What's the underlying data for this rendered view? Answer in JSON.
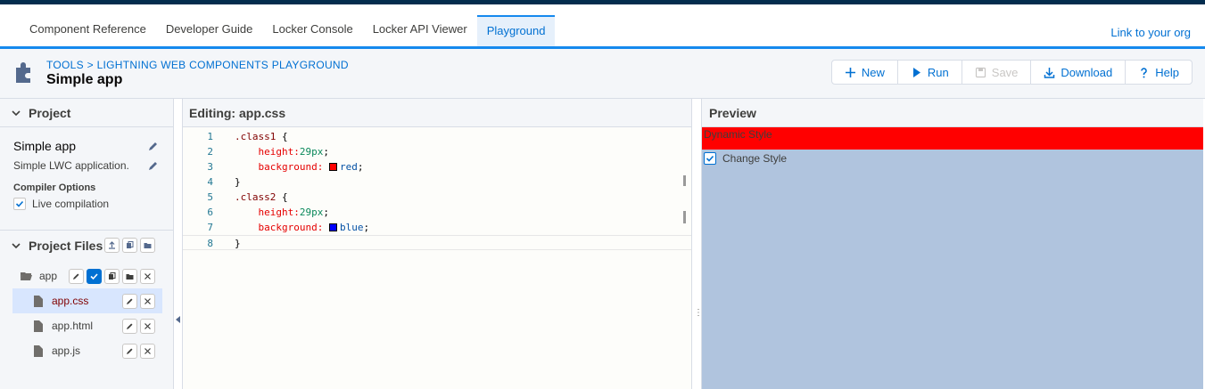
{
  "nav": {
    "tabs": [
      "Component Reference",
      "Developer Guide",
      "Locker Console",
      "Locker API Viewer",
      "Playground"
    ],
    "active_tab": "Playground",
    "org_link": "Link to your org"
  },
  "header": {
    "breadcrumb_tools": "TOOLS",
    "breadcrumb_sep": ">",
    "breadcrumb_page": "LIGHTNING WEB COMPONENTS PLAYGROUND",
    "title": "Simple app",
    "buttons": {
      "new": "New",
      "run": "Run",
      "save": "Save",
      "download": "Download",
      "help": "Help"
    }
  },
  "project": {
    "section_title": "Project",
    "name": "Simple app",
    "description": "Simple LWC application.",
    "compiler_options_title": "Compiler Options",
    "live_compilation_label": "Live compilation",
    "live_compilation": true
  },
  "project_files": {
    "section_title": "Project Files",
    "folder": "app",
    "files": [
      "app.css",
      "app.html",
      "app.js"
    ],
    "selected": "app.css"
  },
  "editor": {
    "heading": "Editing: app.css",
    "line_numbers": [
      "1",
      "2",
      "3",
      "4",
      "5",
      "6",
      "7",
      "8"
    ],
    "code": {
      "l1_sel": ".class1",
      "l1_rest": " {",
      "l2_prop": "height:",
      "l2_val": "29px",
      "l2_end": ";",
      "l3_prop": "background: ",
      "l3_val": "red",
      "l3_end": ";",
      "l4": "}",
      "l5_sel": ".class2",
      "l5_rest": " {",
      "l6_prop": "height:",
      "l6_val": "29px",
      "l6_end": ";",
      "l7_prop": "background: ",
      "l7_val": "blue",
      "l7_end": ";",
      "l8": "}"
    },
    "colors": {
      "red_swatch": "#ff0000",
      "blue_swatch": "#0000ff"
    }
  },
  "preview": {
    "heading": "Preview",
    "dynamic_style_text": "Dynamic Style",
    "change_style_label": "Change Style",
    "change_style_checked": true,
    "colors": {
      "dynamic_bg": "#ff0000",
      "body_bg": "#b0c4de"
    }
  }
}
